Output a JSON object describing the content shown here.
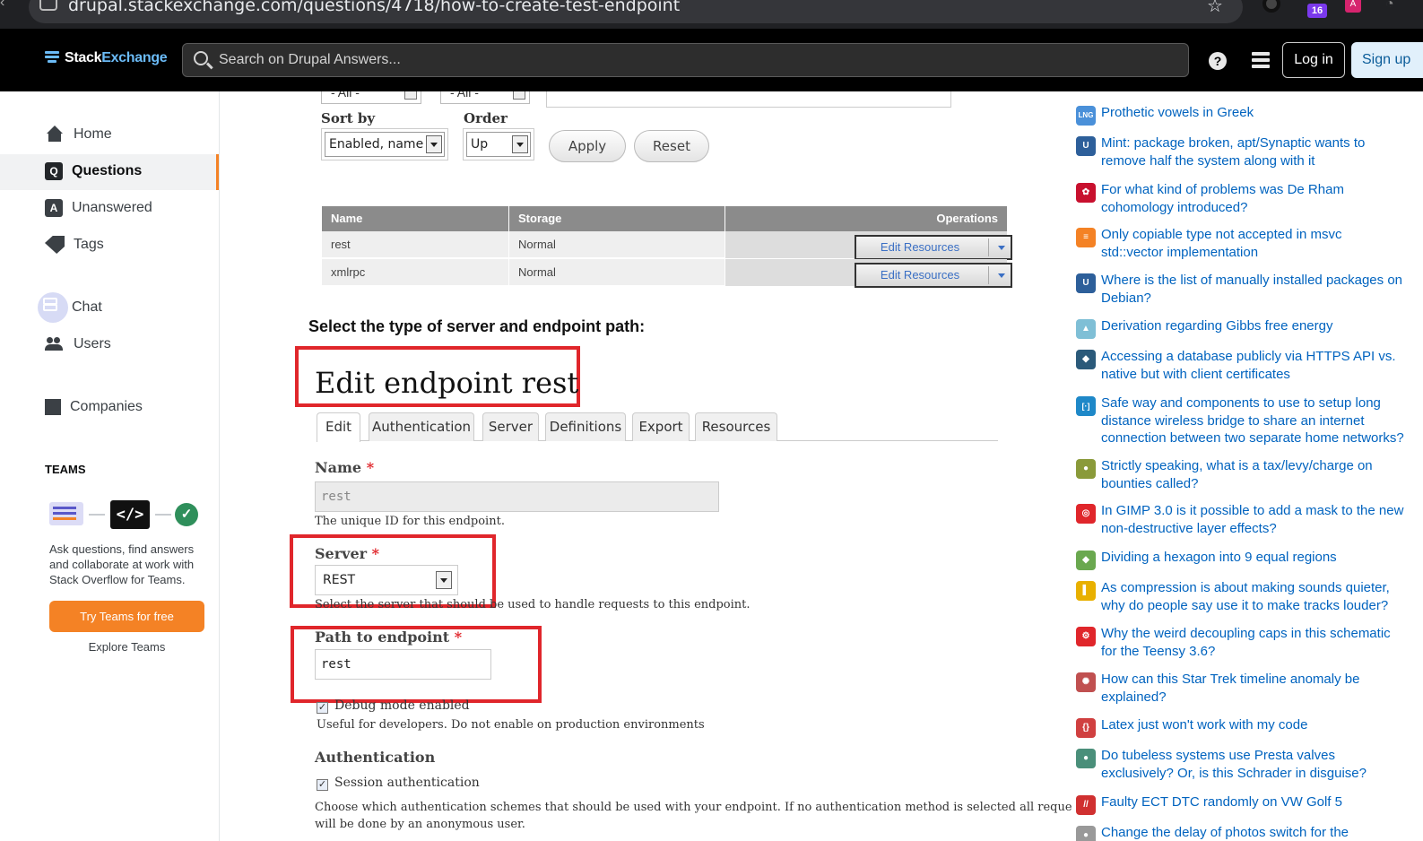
{
  "browser": {
    "url": "drupal.stackexchange.com/questions/4718/how-to-create-test-endpoint",
    "ext_badge": "16",
    "ext_label": "A"
  },
  "header": {
    "logo_stack": "Stack",
    "logo_exchange": "Exchange",
    "search_placeholder": "Search on Drupal Answers...",
    "help_icon": "?",
    "login": "Log in",
    "signup": "Sign up"
  },
  "nav": {
    "home": "Home",
    "questions": "Questions",
    "unanswered": "Unanswered",
    "tags": "Tags",
    "chat": "Chat",
    "users": "Users",
    "companies": "Companies",
    "teams_title": "TEAMS",
    "teams_desc": "Ask questions, find answers and collaborate at work with Stack Overflow for Teams.",
    "teams_btn": "Try Teams for free",
    "explore": "Explore Teams",
    "code_icon_text": "</>"
  },
  "screenshot": {
    "dd1": "- All -",
    "dd2": "- All -",
    "sort_label": "Sort by",
    "order_label": "Order",
    "sort_value": "Enabled, name",
    "order_value": "Up",
    "apply": "Apply",
    "reset": "Reset",
    "table": {
      "headers": [
        "Name",
        "Storage",
        "Operations"
      ],
      "rows": [
        {
          "name": "rest",
          "storage": "Normal",
          "op": "Edit Resources"
        },
        {
          "name": "xmlrpc",
          "storage": "Normal",
          "op": "Edit Resources"
        }
      ]
    },
    "section_heading": "Select the type of server and endpoint path:",
    "edit_title": "Edit endpoint rest",
    "tabs": [
      "Edit",
      "Authentication",
      "Server",
      "Definitions",
      "Export",
      "Resources"
    ],
    "name_label": "Name",
    "required_mark": "*",
    "name_value": "rest",
    "name_desc": "The unique ID for this endpoint.",
    "server_label": "Server",
    "server_value": "REST",
    "server_desc": "Select the server that should be used to handle requests to this endpoint.",
    "path_label": "Path to endpoint",
    "path_value": "rest",
    "debug_label": "Debug mode enabled",
    "debug_desc": "Useful for developers. Do not enable on production environments",
    "auth_heading": "Authentication",
    "session_label": "Session authentication",
    "auth_desc_1": "Choose which authentication schemes that should be used with your endpoint. If no authentication method is selected all requests",
    "auth_desc_2": "will be done by an anonymous user."
  },
  "hot_questions": [
    {
      "title": "Prothetic vowels in Greek",
      "icon": "LNG",
      "color": "#4a90d9"
    },
    {
      "title": "Mint: package broken, apt/Synaptic wants to remove half the system along with it",
      "icon": "U",
      "color": "#2d5f9a"
    },
    {
      "title": "For what kind of problems was De Rham cohomology introduced?",
      "icon": "✿",
      "color": "#c8102e"
    },
    {
      "title": "Only copiable type not accepted in msvc std::vector implementation",
      "icon": "≡",
      "color": "#f48225"
    },
    {
      "title": "Where is the list of manually installed packages on Debian?",
      "icon": "U",
      "color": "#2d5f9a"
    },
    {
      "title": "Derivation regarding Gibbs free energy",
      "icon": "▲",
      "color": "#7fbfd6"
    },
    {
      "title": "Accessing a database publicly via HTTPS API vs. native but with client certificates",
      "icon": "◆",
      "color": "#2b5a7a"
    },
    {
      "title": "Safe way and components to use to setup long distance wireless bridge to share an internet connection between two separate home networks?",
      "icon": "[·]",
      "color": "#1e88c8"
    },
    {
      "title": "Strictly speaking, what is a tax/levy/charge on bounties called?",
      "icon": "●",
      "color": "#8a9a3a"
    },
    {
      "title": "In GIMP 3.0 is it possible to add a mask to the new non-destructive layer effects?",
      "icon": "◎",
      "color": "#e0262b"
    },
    {
      "title": "Dividing a hexagon into 9 equal regions",
      "icon": "◆",
      "color": "#6aa84f"
    },
    {
      "title": "As compression is about making sounds quieter, why do people say use it to make tracks louder?",
      "icon": "▌",
      "color": "#e8b000"
    },
    {
      "title": "Why the weird decoupling caps in this schematic for the Teensy 3.6?",
      "icon": "⚙",
      "color": "#e0262b"
    },
    {
      "title": "How can this Star Trek timeline anomaly be explained?",
      "icon": "✺",
      "color": "#c05050"
    },
    {
      "title": "Latex just won't work with my code",
      "icon": "{}",
      "color": "#d04040"
    },
    {
      "title": "Do tubeless systems use Presta valves exclusively? Or, is this Schrader in disguise?",
      "icon": "●",
      "color": "#4a8f7a"
    },
    {
      "title": "Faulty ECT DTC randomly on VW Golf 5",
      "icon": "//",
      "color": "#d03030"
    },
    {
      "title": "Change the delay of photos switch for the",
      "icon": "●",
      "color": "#999999"
    }
  ]
}
